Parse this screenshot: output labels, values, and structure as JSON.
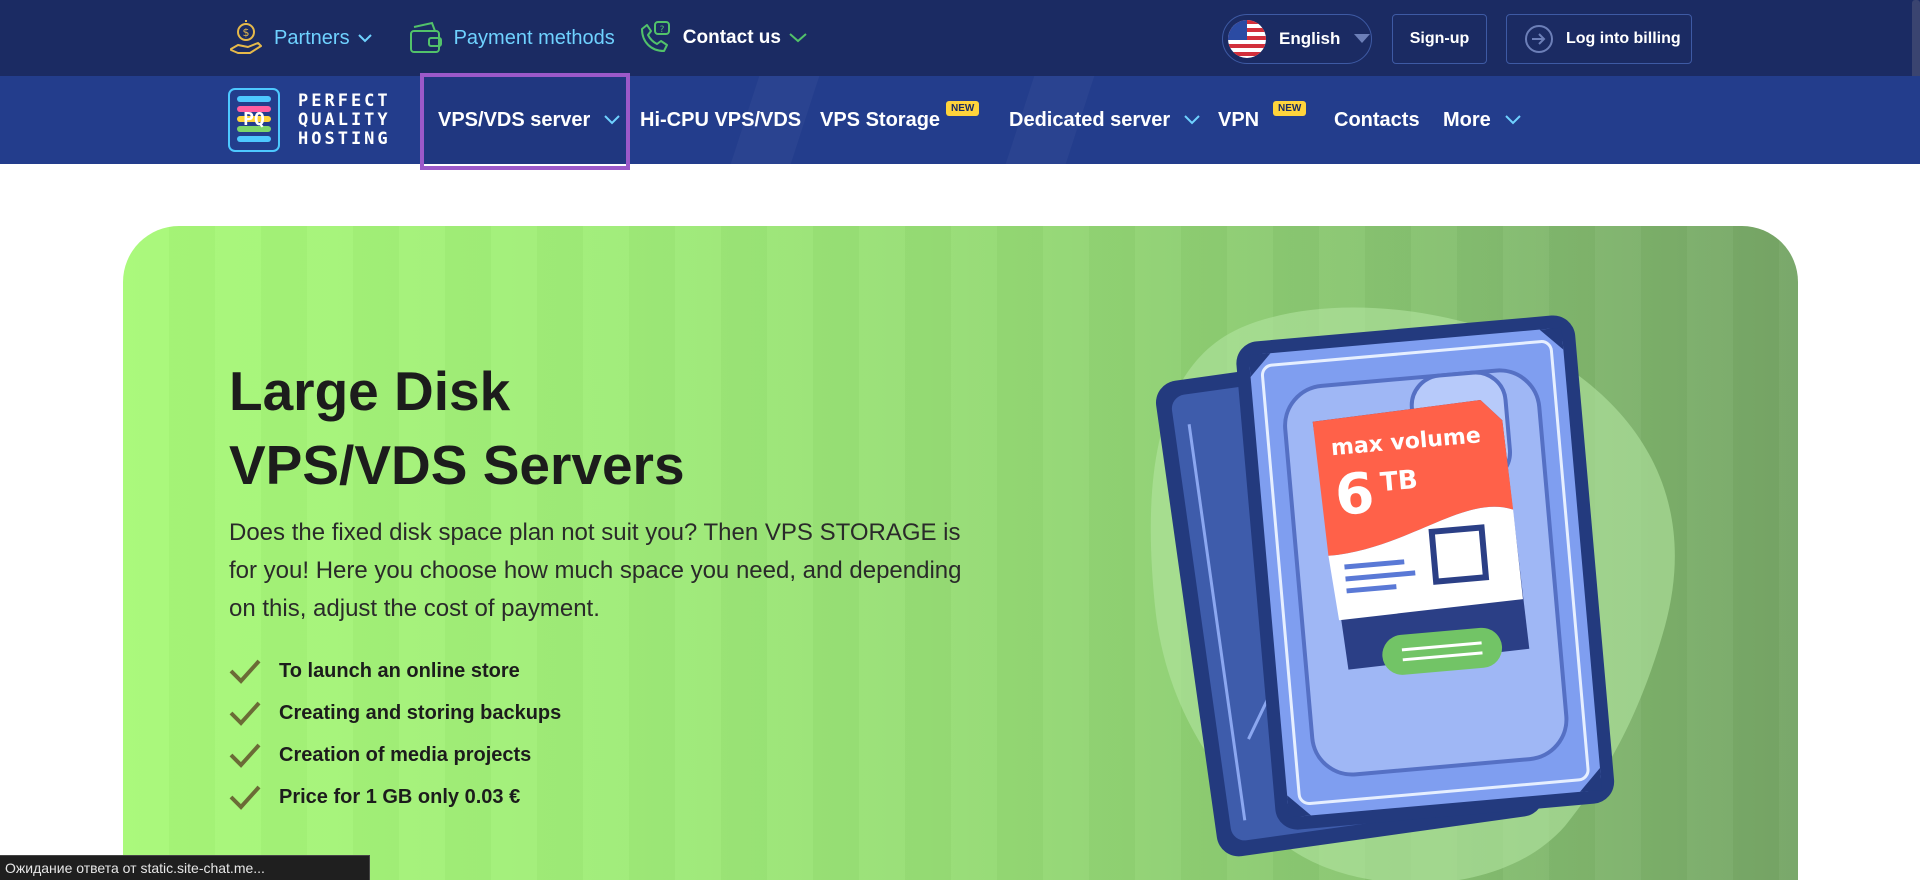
{
  "topbar": {
    "partners": "Partners",
    "payment_methods": "Payment methods",
    "contact_us": "Contact us",
    "language": "English",
    "signup": "Sign-up",
    "login_billing": "Log into billing"
  },
  "logo": {
    "line1": "PERFECT",
    "line2": "QUALITY",
    "line3": "HOSTING",
    "mark": "PQ"
  },
  "nav": {
    "vps_vds": "VPS/VDS server",
    "hicpu": "Hi-CPU VPS/VDS",
    "vps_storage": "VPS Storage",
    "dedicated": "Dedicated server",
    "vpn": "VPN",
    "contacts": "Contacts",
    "more": "More",
    "new_badge": "NEW"
  },
  "hero": {
    "title_line1": "Large Disk",
    "title_line2": "VPS/VDS Servers",
    "description": "Does the fixed disk space plan not suit you? Then VPS STORAGE is for you! Here you choose how much space you need, and depending on this, adjust the cost of payment.",
    "features": [
      "To launch an online store",
      "Creating and storing backups",
      "Creation of media projects",
      "Price for 1 GB only 0.03 €"
    ],
    "disk_label_top": "max volume",
    "disk_label_value": "6",
    "disk_label_unit": "TB"
  },
  "status_bar": "Ожидание ответа от static.site-chat.me...",
  "colors": {
    "topbar": "#1b2b63",
    "navbar": "#233d8c",
    "accent_link": "#6fd2ff",
    "hero_green": "#a8f978",
    "highlight": "#9b59c9",
    "badge": "#ffd43b"
  }
}
